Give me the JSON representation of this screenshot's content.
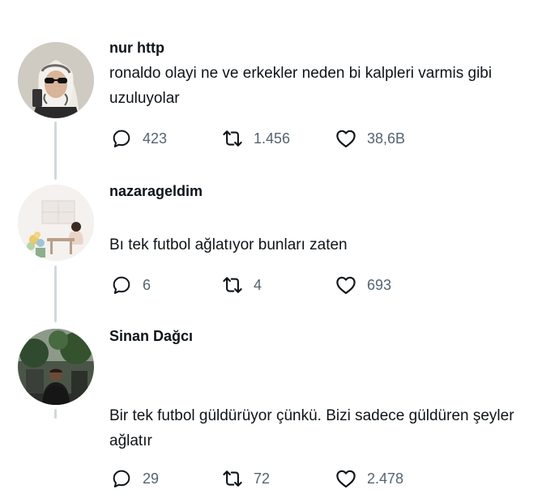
{
  "theme": {
    "text": "#0f1419",
    "secondary": "#536471",
    "thread_line": "#cfd9de"
  },
  "tweets": [
    {
      "author": "nur http",
      "text": "ronaldo olayi ne ve erkekler neden bi kalpleri varmis gibi uzuluyolar",
      "replies": "423",
      "retweets": "1.456",
      "likes": "38,6B",
      "avatar": "profile-photo-woman-headscarf-sunglasses"
    },
    {
      "author": "nazarageldim",
      "text": "Bı tek futbol ağlatıyor bunları zaten",
      "replies": "6",
      "retweets": "4",
      "likes": "693",
      "avatar": "illustration-woman-reading-flowers"
    },
    {
      "author": "Sinan Dağcı",
      "text": "Bir tek futbol güldürüyor çünkü. Bizi sadece güldüren şeyler ağlatır",
      "replies": "29",
      "retweets": "72",
      "likes": "2.478",
      "avatar": "profile-photo-man-outdoors-trees"
    }
  ],
  "icons": {
    "reply": "reply-icon",
    "retweet": "retweet-icon",
    "like": "like-icon"
  }
}
